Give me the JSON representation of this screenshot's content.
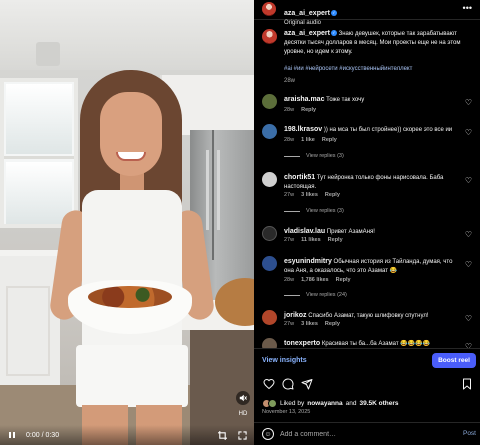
{
  "video": {
    "time": "0:00 / 0:30",
    "sound_icon": "speaker-muted-icon",
    "hd_label": "HD"
  },
  "post": {
    "username": "aza_ai_expert",
    "audio": "Original audio",
    "caption": "Знаю девушек, которые так зарабатывают десятки тысяч долларов в месяц. Мои проекты еще не на этом уровне, но идем к этому.",
    "hashtags": "#ai #ии #нейросети #искусственныйинтеллект",
    "time": "28w",
    "liked_by_prefix": "Liked by",
    "liked_by_user": "nowayanna",
    "liked_by_and": "and",
    "likes_count": "39.5K others",
    "date": "November 13, 2025"
  },
  "comments": [
    {
      "user": "araisha.mac",
      "text": "Тоже так хочу",
      "time": "28w",
      "likes": "",
      "reply": "Reply",
      "replies": "",
      "avatar": "#5c6e3a"
    },
    {
      "user": "198.lkrasov",
      "text": ")) на мса ты был стройнее)) скорее это все ии",
      "time": "28w",
      "likes": "1 like",
      "reply": "Reply",
      "replies": "View replies (3)",
      "avatar": "#3b6ea8"
    },
    {
      "user": "chortik51",
      "text": "Тут нейронка только фоны нарисовала. Баба настоящая.",
      "time": "27w",
      "likes": "3 likes",
      "reply": "Reply",
      "replies": "View replies (3)",
      "avatar": "#cfcfcf"
    },
    {
      "user": "vladislav.lau",
      "text": "Привет АзамАня!",
      "time": "27w",
      "likes": "11 likes",
      "reply": "Reply",
      "replies": "",
      "avatar": "#2a2a2a"
    },
    {
      "user": "esyunindmitry",
      "text": "Обычная история из Тайланда, думая, что она Аня, а оказалось, что это Азамат 😂",
      "time": "28w",
      "likes": "1,786 likes",
      "reply": "Reply",
      "replies": "View replies (24)",
      "avatar": "#2d4f8f"
    },
    {
      "user": "jorikoz",
      "text": "Спасибо Азамат, такую шлифовку спутнул!",
      "time": "27w",
      "likes": "3 likes",
      "reply": "Reply",
      "replies": "",
      "avatar": "#b1462a"
    },
    {
      "user": "tonexperto",
      "text": "Красивая ты ба...ба Азамат 😂😂😂😂",
      "time": "",
      "likes": "",
      "reply": "",
      "replies": "",
      "avatar": "#6b5a4a"
    }
  ],
  "insights": {
    "label": "View insights",
    "boost": "Boost reel"
  },
  "composer": {
    "placeholder": "Add a comment…",
    "post": "Post"
  },
  "icons": {
    "more": "more-horizontal-icon",
    "heart": "heart-icon",
    "comment": "comment-icon",
    "share": "share-icon",
    "save": "bookmark-icon",
    "emoji": "emoji-icon"
  }
}
